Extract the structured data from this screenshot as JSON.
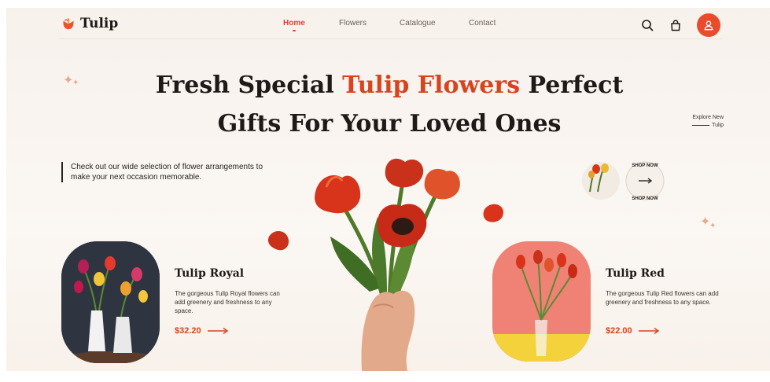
{
  "brand": {
    "name": "Tulip"
  },
  "nav": {
    "items": [
      {
        "label": "Home",
        "active": true
      },
      {
        "label": "Flowers",
        "active": false
      },
      {
        "label": "Catalogue",
        "active": false
      },
      {
        "label": "Contact",
        "active": false
      }
    ],
    "icons": [
      "search-icon",
      "bag-icon",
      "user-icon"
    ]
  },
  "hero": {
    "title_part1": "Fresh Special ",
    "title_accent": "Tulip Flowers",
    "title_part2": " Perfect",
    "title_line2": "Gifts For Your Loved Ones",
    "intro": "Check out our wide selection of flower arrangements to make your next occasion memorable.",
    "explore_line1": "Explore New",
    "explore_line2": "Tulip",
    "badge_text": "SHOP NOW  SHOP NOW"
  },
  "products": [
    {
      "name": "Tulip Royal",
      "description": "The gorgeous Tulip Royal flowers can add greenery and freshness to any space.",
      "price": "$32.20"
    },
    {
      "name": "Tulip Red",
      "description": "The gorgeous Tulip Red flowers can add greenery and freshness to any space.",
      "price": "$22.00"
    }
  ],
  "colors": {
    "accent": "#d9431f",
    "background": "#f7f1ec",
    "text": "#1f1a17"
  }
}
